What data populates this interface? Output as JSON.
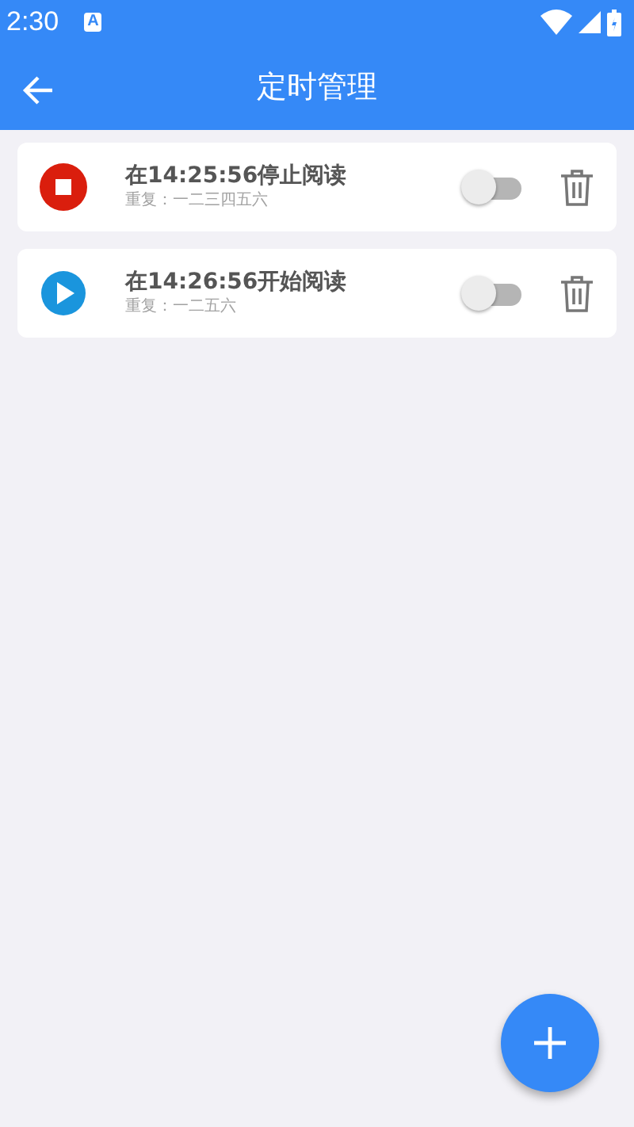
{
  "status_bar": {
    "time": "2:30",
    "notification_glyph": "A"
  },
  "app_bar": {
    "title": "定时管理"
  },
  "timers": [
    {
      "kind": "stop",
      "title": "在14:25:56停止阅读",
      "repeat": "重复：一二三四五六",
      "on": false
    },
    {
      "kind": "play",
      "title": "在14:26:56开始阅读",
      "repeat": "重复：一二五六",
      "on": false
    }
  ]
}
